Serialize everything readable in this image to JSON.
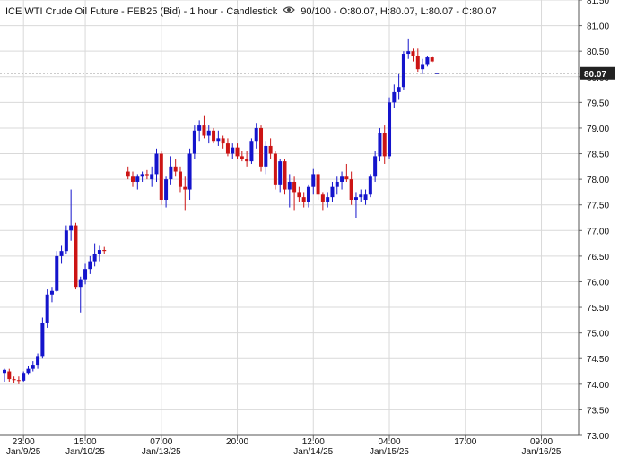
{
  "header": {
    "title": "ICE WTI Crude Oil Future - FEB25 (Bid) - 1 hour - Candlestick",
    "scale": "90/100",
    "open": "O:80.07",
    "high": "H:80.07",
    "low": "L:80.07",
    "close": "C:80.07"
  },
  "colors": {
    "up": "#1414cc",
    "down": "#cc1414",
    "grid": "#d9d9d9",
    "last_line": "#333333"
  },
  "chart_data": {
    "type": "candlestick",
    "title": "ICE WTI Crude Oil Future - FEB25 (Bid) - 1 hour - Candlestick",
    "last_price": "80.07",
    "ylim": [
      73.0,
      81.5
    ],
    "xlim": [
      0,
      118
    ],
    "y_ticks": [
      "81.50",
      "81.00",
      "80.50",
      "80.00",
      "79.50",
      "79.00",
      "78.50",
      "78.00",
      "77.50",
      "77.00",
      "76.50",
      "76.00",
      "75.50",
      "75.00",
      "74.50",
      "74.00",
      "73.50",
      "73.00"
    ],
    "x_ticks": [
      {
        "i": 4,
        "time": "23:00",
        "date": "Jan/9/25"
      },
      {
        "i": 17,
        "time": "15:00",
        "date": "Jan/10/25"
      },
      {
        "i": 33,
        "time": "07:00",
        "date": "Jan/13/25"
      },
      {
        "i": 49,
        "time": "20:00",
        "date": ""
      },
      {
        "i": 65,
        "time": "12:00",
        "date": "Jan/14/25"
      },
      {
        "i": 81,
        "time": "04:00",
        "date": "Jan/15/25"
      },
      {
        "i": 97,
        "time": "17:00",
        "date": ""
      },
      {
        "i": 113,
        "time": "09:00",
        "date": "Jan/16/25"
      }
    ],
    "candles": [
      {
        "i": 0,
        "o": 74.22,
        "h": 74.3,
        "l": 74.05,
        "c": 74.28
      },
      {
        "i": 1,
        "o": 74.25,
        "h": 74.3,
        "l": 74.05,
        "c": 74.1
      },
      {
        "i": 2,
        "o": 74.1,
        "h": 74.15,
        "l": 74.02,
        "c": 74.08
      },
      {
        "i": 3,
        "o": 74.08,
        "h": 74.15,
        "l": 74.0,
        "c": 74.07
      },
      {
        "i": 4,
        "o": 74.07,
        "h": 74.25,
        "l": 74.05,
        "c": 74.22
      },
      {
        "i": 5,
        "o": 74.22,
        "h": 74.35,
        "l": 74.18,
        "c": 74.3
      },
      {
        "i": 6,
        "o": 74.3,
        "h": 74.45,
        "l": 74.25,
        "c": 74.38
      },
      {
        "i": 7,
        "o": 74.38,
        "h": 74.6,
        "l": 74.3,
        "c": 74.55
      },
      {
        "i": 8,
        "o": 74.55,
        "h": 75.3,
        "l": 74.5,
        "c": 75.2
      },
      {
        "i": 9,
        "o": 75.2,
        "h": 75.85,
        "l": 75.1,
        "c": 75.75
      },
      {
        "i": 10,
        "o": 75.75,
        "h": 75.9,
        "l": 75.6,
        "c": 75.82
      },
      {
        "i": 11,
        "o": 75.82,
        "h": 76.6,
        "l": 75.8,
        "c": 76.5
      },
      {
        "i": 12,
        "o": 76.5,
        "h": 76.7,
        "l": 76.35,
        "c": 76.6
      },
      {
        "i": 13,
        "o": 76.6,
        "h": 77.1,
        "l": 76.55,
        "c": 77.0
      },
      {
        "i": 14,
        "o": 77.0,
        "h": 77.8,
        "l": 76.8,
        "c": 77.1
      },
      {
        "i": 15,
        "o": 77.1,
        "h": 77.15,
        "l": 75.85,
        "c": 75.9
      },
      {
        "i": 16,
        "o": 75.9,
        "h": 76.1,
        "l": 75.4,
        "c": 76.05
      },
      {
        "i": 17,
        "o": 76.05,
        "h": 76.35,
        "l": 75.95,
        "c": 76.25
      },
      {
        "i": 18,
        "o": 76.25,
        "h": 76.5,
        "l": 76.15,
        "c": 76.4
      },
      {
        "i": 19,
        "o": 76.4,
        "h": 76.75,
        "l": 76.3,
        "c": 76.55
      },
      {
        "i": 20,
        "o": 76.55,
        "h": 76.7,
        "l": 76.4,
        "c": 76.62
      },
      {
        "i": 21,
        "o": 76.62,
        "h": 76.68,
        "l": 76.55,
        "c": 76.6
      },
      {
        "i": 26,
        "o": 78.15,
        "h": 78.25,
        "l": 78.0,
        "c": 78.05
      },
      {
        "i": 27,
        "o": 78.05,
        "h": 78.15,
        "l": 77.85,
        "c": 77.95
      },
      {
        "i": 28,
        "o": 77.95,
        "h": 78.1,
        "l": 77.8,
        "c": 78.05
      },
      {
        "i": 29,
        "o": 78.05,
        "h": 78.15,
        "l": 77.95,
        "c": 78.1
      },
      {
        "i": 30,
        "o": 78.1,
        "h": 78.18,
        "l": 78.0,
        "c": 78.08
      },
      {
        "i": 31,
        "o": 78.0,
        "h": 78.25,
        "l": 77.85,
        "c": 78.1
      },
      {
        "i": 32,
        "o": 78.1,
        "h": 78.6,
        "l": 77.95,
        "c": 78.5
      },
      {
        "i": 33,
        "o": 78.5,
        "h": 78.55,
        "l": 77.5,
        "c": 77.6
      },
      {
        "i": 34,
        "o": 77.6,
        "h": 78.05,
        "l": 77.45,
        "c": 78.0
      },
      {
        "i": 35,
        "o": 78.0,
        "h": 78.45,
        "l": 77.9,
        "c": 78.25
      },
      {
        "i": 36,
        "o": 78.25,
        "h": 78.4,
        "l": 78.05,
        "c": 78.15
      },
      {
        "i": 37,
        "o": 78.15,
        "h": 78.25,
        "l": 77.75,
        "c": 77.85
      },
      {
        "i": 38,
        "o": 77.85,
        "h": 78.05,
        "l": 77.4,
        "c": 77.8
      },
      {
        "i": 39,
        "o": 77.8,
        "h": 78.6,
        "l": 77.6,
        "c": 78.5
      },
      {
        "i": 40,
        "o": 78.5,
        "h": 79.05,
        "l": 78.4,
        "c": 78.95
      },
      {
        "i": 41,
        "o": 78.95,
        "h": 79.15,
        "l": 78.75,
        "c": 79.05
      },
      {
        "i": 42,
        "o": 79.05,
        "h": 79.25,
        "l": 78.8,
        "c": 78.85
      },
      {
        "i": 43,
        "o": 78.85,
        "h": 79.05,
        "l": 78.7,
        "c": 78.95
      },
      {
        "i": 44,
        "o": 78.95,
        "h": 79.0,
        "l": 78.7,
        "c": 78.75
      },
      {
        "i": 45,
        "o": 78.75,
        "h": 78.95,
        "l": 78.65,
        "c": 78.8
      },
      {
        "i": 46,
        "o": 78.8,
        "h": 78.85,
        "l": 78.6,
        "c": 78.7
      },
      {
        "i": 47,
        "o": 78.7,
        "h": 78.8,
        "l": 78.45,
        "c": 78.5
      },
      {
        "i": 48,
        "o": 78.5,
        "h": 78.7,
        "l": 78.4,
        "c": 78.62
      },
      {
        "i": 49,
        "o": 78.62,
        "h": 78.7,
        "l": 78.4,
        "c": 78.45
      },
      {
        "i": 50,
        "o": 78.45,
        "h": 78.55,
        "l": 78.35,
        "c": 78.4
      },
      {
        "i": 51,
        "o": 78.4,
        "h": 78.55,
        "l": 78.25,
        "c": 78.35
      },
      {
        "i": 52,
        "o": 78.35,
        "h": 78.8,
        "l": 78.3,
        "c": 78.75
      },
      {
        "i": 53,
        "o": 78.75,
        "h": 79.1,
        "l": 78.6,
        "c": 79.0
      },
      {
        "i": 54,
        "o": 79.0,
        "h": 79.05,
        "l": 78.15,
        "c": 78.25
      },
      {
        "i": 55,
        "o": 78.25,
        "h": 78.75,
        "l": 78.1,
        "c": 78.65
      },
      {
        "i": 56,
        "o": 78.65,
        "h": 78.8,
        "l": 78.4,
        "c": 78.5
      },
      {
        "i": 57,
        "o": 78.5,
        "h": 78.55,
        "l": 77.8,
        "c": 77.9
      },
      {
        "i": 58,
        "o": 77.9,
        "h": 78.4,
        "l": 77.75,
        "c": 78.35
      },
      {
        "i": 59,
        "o": 78.35,
        "h": 78.4,
        "l": 77.7,
        "c": 77.8
      },
      {
        "i": 60,
        "o": 77.8,
        "h": 78.1,
        "l": 77.45,
        "c": 77.95
      },
      {
        "i": 61,
        "o": 77.95,
        "h": 78.05,
        "l": 77.4,
        "c": 77.75
      },
      {
        "i": 62,
        "o": 77.75,
        "h": 77.85,
        "l": 77.55,
        "c": 77.65
      },
      {
        "i": 63,
        "o": 77.65,
        "h": 77.75,
        "l": 77.45,
        "c": 77.55
      },
      {
        "i": 64,
        "o": 77.55,
        "h": 77.9,
        "l": 77.45,
        "c": 77.85
      },
      {
        "i": 65,
        "o": 77.85,
        "h": 78.2,
        "l": 77.7,
        "c": 78.1
      },
      {
        "i": 66,
        "o": 78.1,
        "h": 78.15,
        "l": 77.6,
        "c": 77.7
      },
      {
        "i": 67,
        "o": 77.7,
        "h": 77.75,
        "l": 77.4,
        "c": 77.55
      },
      {
        "i": 68,
        "o": 77.55,
        "h": 77.75,
        "l": 77.45,
        "c": 77.65
      },
      {
        "i": 69,
        "o": 77.65,
        "h": 77.95,
        "l": 77.55,
        "c": 77.85
      },
      {
        "i": 70,
        "o": 77.85,
        "h": 78.05,
        "l": 77.7,
        "c": 77.95
      },
      {
        "i": 71,
        "o": 77.95,
        "h": 78.15,
        "l": 77.8,
        "c": 78.05
      },
      {
        "i": 72,
        "o": 78.05,
        "h": 78.3,
        "l": 77.95,
        "c": 78.0
      },
      {
        "i": 73,
        "o": 78.0,
        "h": 78.15,
        "l": 77.5,
        "c": 77.6
      },
      {
        "i": 74,
        "o": 77.6,
        "h": 77.75,
        "l": 77.25,
        "c": 77.65
      },
      {
        "i": 75,
        "o": 77.65,
        "h": 77.8,
        "l": 77.55,
        "c": 77.7
      },
      {
        "i": 76,
        "o": 77.6,
        "h": 77.8,
        "l": 77.5,
        "c": 77.7
      },
      {
        "i": 77,
        "o": 77.7,
        "h": 78.1,
        "l": 77.65,
        "c": 78.05
      },
      {
        "i": 78,
        "o": 78.05,
        "h": 78.55,
        "l": 77.95,
        "c": 78.45
      },
      {
        "i": 79,
        "o": 78.45,
        "h": 79.0,
        "l": 78.35,
        "c": 78.9
      },
      {
        "i": 80,
        "o": 78.9,
        "h": 79.05,
        "l": 78.3,
        "c": 78.45
      },
      {
        "i": 81,
        "o": 78.45,
        "h": 79.6,
        "l": 78.4,
        "c": 79.5
      },
      {
        "i": 82,
        "o": 79.5,
        "h": 79.85,
        "l": 79.4,
        "c": 79.7
      },
      {
        "i": 83,
        "o": 79.7,
        "h": 80.05,
        "l": 79.55,
        "c": 79.8
      },
      {
        "i": 84,
        "o": 79.8,
        "h": 80.5,
        "l": 79.75,
        "c": 80.45
      },
      {
        "i": 85,
        "o": 80.45,
        "h": 80.75,
        "l": 80.35,
        "c": 80.5
      },
      {
        "i": 86,
        "o": 80.5,
        "h": 80.55,
        "l": 80.3,
        "c": 80.4
      },
      {
        "i": 87,
        "o": 80.4,
        "h": 80.55,
        "l": 80.1,
        "c": 80.15
      },
      {
        "i": 88,
        "o": 80.15,
        "h": 80.35,
        "l": 80.05,
        "c": 80.25
      },
      {
        "i": 89,
        "o": 80.25,
        "h": 80.4,
        "l": 80.2,
        "c": 80.38
      },
      {
        "i": 90,
        "o": 80.38,
        "h": 80.4,
        "l": 80.28,
        "c": 80.3
      },
      {
        "i": 91,
        "o": 80.07,
        "h": 80.07,
        "l": 80.07,
        "c": 80.07
      }
    ]
  }
}
